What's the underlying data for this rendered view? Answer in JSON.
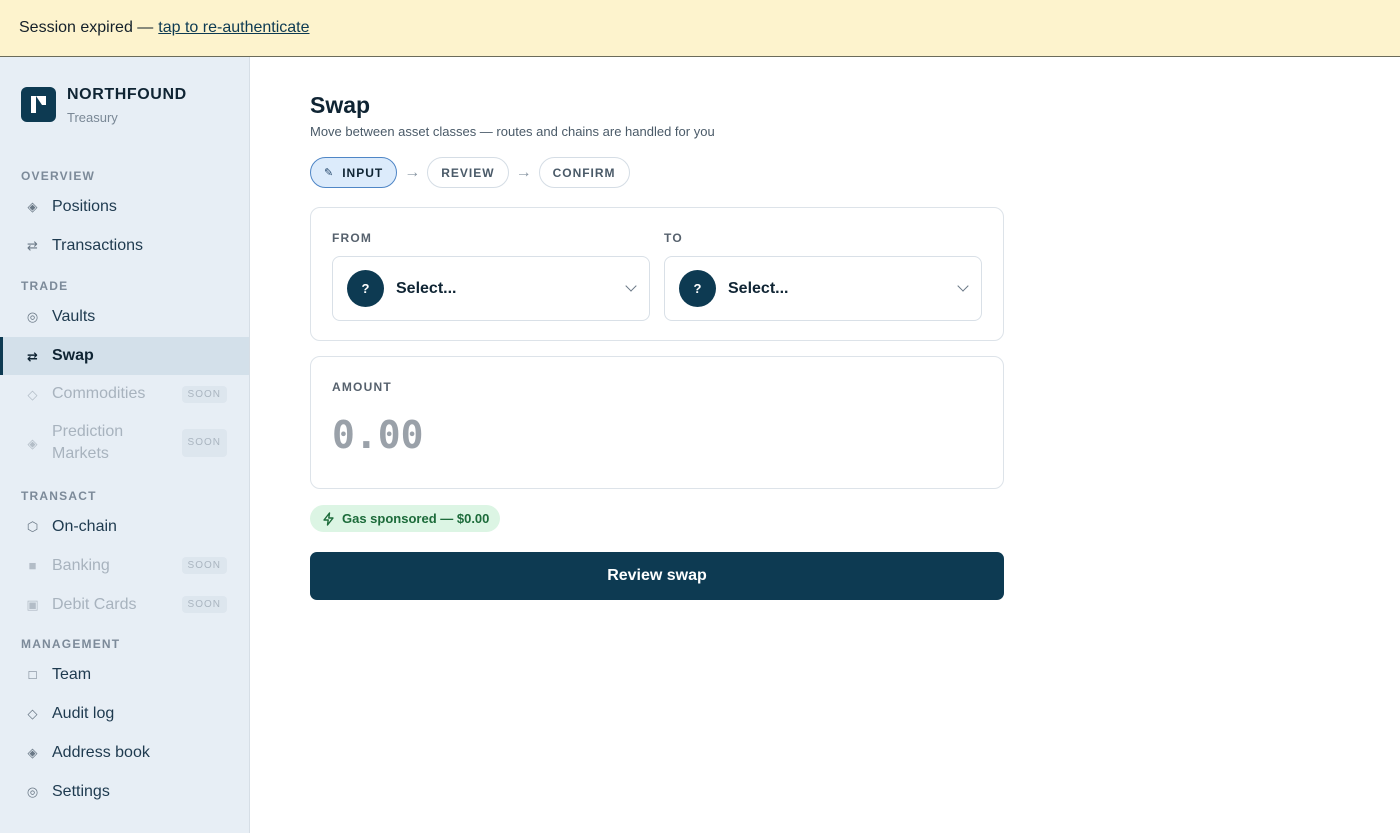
{
  "banner": {
    "text": "Session expired —",
    "link": "tap to re-authenticate"
  },
  "brand": {
    "name": "NORTHFOUND",
    "sub": "Treasury"
  },
  "sidebar": {
    "sections": {
      "overview": "OVERVIEW",
      "trade": "TRADE",
      "transact": "TRANSACT",
      "management": "MANAGEMENT"
    },
    "items": {
      "positions": {
        "label": "Positions",
        "icon": "diamond-icon"
      },
      "transactions": {
        "label": "Transactions",
        "icon": "arrows-icon"
      },
      "vaults": {
        "label": "Vaults",
        "icon": "ring-icon"
      },
      "swap": {
        "label": "Swap",
        "icon": "swap-icon",
        "active": true
      },
      "commodities": {
        "label": "Commodities",
        "icon": "diamond-outline-icon",
        "badge": "SOON"
      },
      "prediction": {
        "label_line1": "Prediction",
        "label_line2": "Markets",
        "icon": "diamond-icon",
        "badge": "SOON"
      },
      "onchain": {
        "label": "On-chain",
        "icon": "hexagon-icon"
      },
      "banking": {
        "label": "Banking",
        "icon": "square-icon",
        "badge": "SOON"
      },
      "debitcards": {
        "label": "Debit Cards",
        "icon": "card-icon",
        "badge": "SOON"
      },
      "team": {
        "label": "Team",
        "icon": "square-outline-icon"
      },
      "auditlog": {
        "label": "Audit log",
        "icon": "diamond-outline-icon"
      },
      "addressbook": {
        "label": "Address book",
        "icon": "diamond-icon"
      },
      "settings": {
        "label": "Settings",
        "icon": "ring-icon"
      }
    }
  },
  "main": {
    "title": "Swap",
    "subtitle": "Move between asset classes — routes and chains are handled for you",
    "steps": {
      "input": "INPUT",
      "review": "REVIEW",
      "confirm": "CONFIRM"
    },
    "from": {
      "label": "FROM",
      "placeholder": "Select...",
      "icon_text": "?"
    },
    "to": {
      "label": "TO",
      "placeholder": "Select...",
      "icon_text": "?"
    },
    "amount": {
      "label": "AMOUNT",
      "placeholder": "0.00"
    },
    "gas": "Gas sponsored — $0.00",
    "review_button": "Review swap"
  },
  "colors": {
    "accent": "#0d3a52",
    "banner_bg": "#fdf3cd",
    "gas_bg": "#dcf5e4",
    "gas_text": "#1c6b3a"
  }
}
